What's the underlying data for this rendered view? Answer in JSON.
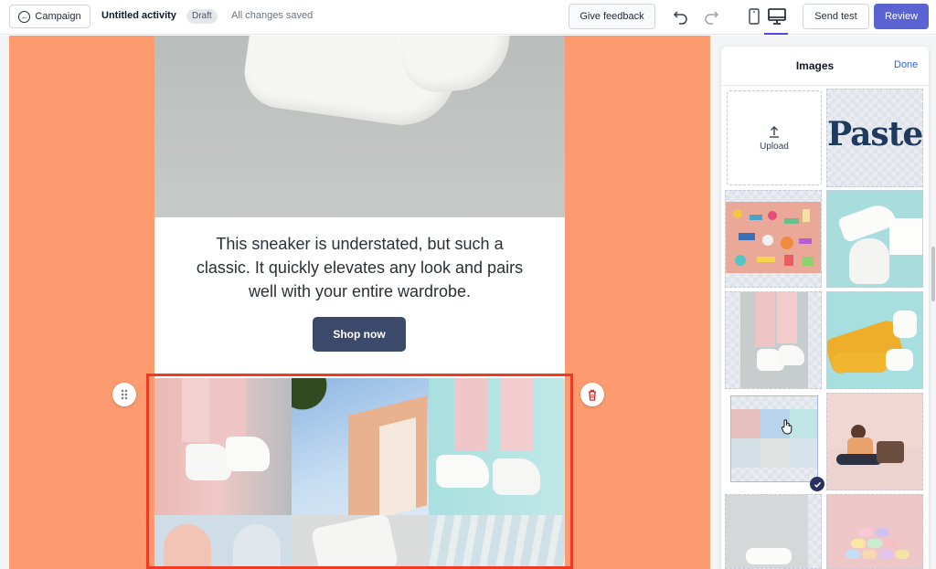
{
  "toolbar": {
    "campaign_label": "Campaign",
    "activity_title": "Untitled activity",
    "draft_badge": "Draft",
    "saved_status": "All changes saved",
    "feedback_label": "Give feedback",
    "send_test_label": "Send test",
    "review_label": "Review",
    "icons": [
      "back-arrow-icon",
      "undo-icon",
      "redo-icon",
      "mobile-preview-icon",
      "desktop-preview-icon"
    ]
  },
  "email": {
    "body_text": "This sneaker is understated, but such a classic. It quickly elevates any look and pairs well with your entire wardrobe.",
    "cta_label": "Shop now",
    "background_color": "#fc9b6f",
    "button_color": "#3b4a6b"
  },
  "selected_block": {
    "border_color": "#ef3a24",
    "icons": [
      "drag-handle-icon",
      "trash-icon"
    ]
  },
  "images_panel": {
    "title": "Images",
    "done_label": "Done",
    "upload_label": "Upload",
    "pastel_logo_text": "Pastel",
    "accent": "#5b63d3",
    "thumbnails": [
      {
        "id": "pastel-logo"
      },
      {
        "id": "colorful-objects"
      },
      {
        "id": "white-sneakers"
      },
      {
        "id": "pink-pants-sneakers"
      },
      {
        "id": "yellow-pants-legs"
      },
      {
        "id": "collage-selected",
        "selected": true
      },
      {
        "id": "person-sitting"
      },
      {
        "id": "sneaker-bottom"
      },
      {
        "id": "macarons"
      }
    ]
  }
}
